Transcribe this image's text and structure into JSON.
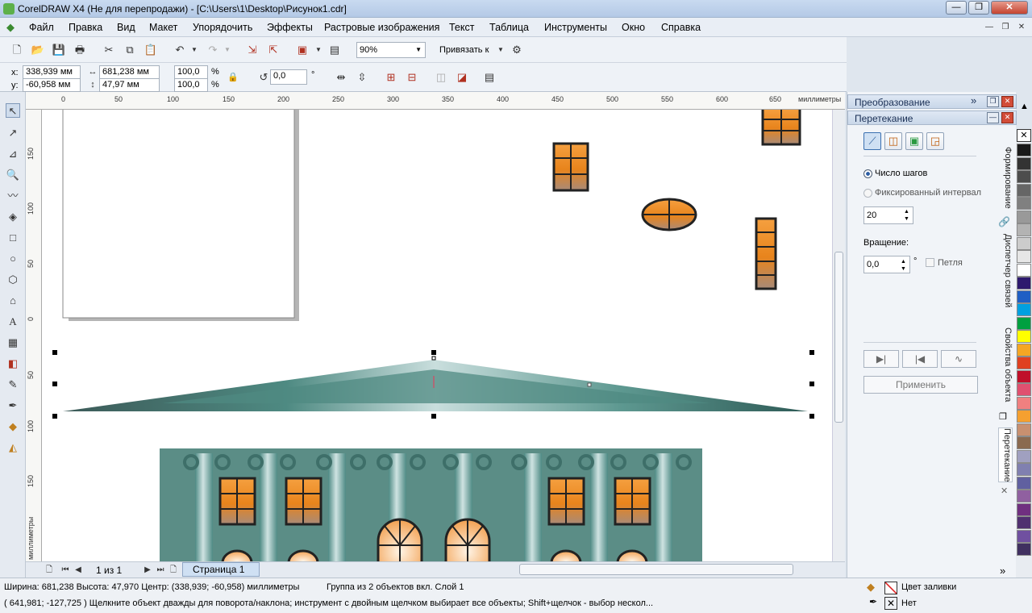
{
  "window": {
    "title": "CorelDRAW X4 (Не для перепродажи) - [C:\\Users\\1\\Desktop\\Рисунок1.cdr]",
    "min": "—",
    "max": "❐",
    "close": "✕"
  },
  "menu": [
    "Файл",
    "Правка",
    "Вид",
    "Макет",
    "Упорядочить",
    "Эффекты",
    "Растровые изображения",
    "Текст",
    "Таблица",
    "Инструменты",
    "Окно",
    "Справка"
  ],
  "toolbar": {
    "zoom": "90%",
    "snap": "Привязать к"
  },
  "props": {
    "x_label": "x:",
    "x": "338,939 мм",
    "y_label": "y:",
    "y": "-60,958 мм",
    "w": "681,238 мм",
    "h": "47,97 мм",
    "sx": "100,0",
    "sy": "100,0",
    "pct": "%",
    "rot": "0,0",
    "deg": "°"
  },
  "rulers": {
    "unit": "миллиметры",
    "top": [
      "0",
      "50",
      "100",
      "150",
      "200",
      "250",
      "300",
      "350",
      "400",
      "450",
      "500",
      "550",
      "600",
      "650"
    ],
    "left": [
      "150",
      "100",
      "50",
      "0",
      "50",
      "100",
      "150"
    ]
  },
  "pages": {
    "counter": "1 из 1",
    "tab": "Страница 1"
  },
  "status": {
    "line1": "Ширина: 681,238  Высота: 47,970  Центр: (338,939; -60,958)  миллиметры",
    "group": "Группа из 2 объектов вкл. Слой 1",
    "line2": "( 641,981; -127,725 )   Щелкните объект дважды для поворота/наклона; инструмент с двойным щелчком выбирает все объекты; Shift+щелчок - выбор нескол...",
    "fill": "Цвет заливки",
    "outline": "Нет"
  },
  "docker": {
    "transform_title": "Преобразование",
    "blend_title": "Перетекание",
    "steps_label": "Число шагов",
    "fixed_label": "Фиксированный интервал",
    "steps": "20",
    "rotation_label": "Вращение:",
    "rotation": "0,0",
    "deg": "°",
    "loop": "Петля",
    "apply": "Применить"
  },
  "vtabs": [
    "Формирование",
    "Диспетчер связей",
    "Свойства объекта",
    "Перетекание"
  ],
  "palette": [
    "#ffffff",
    "#1a1a1a",
    "#333333",
    "#4d4d4d",
    "#666666",
    "#808080",
    "#999999",
    "#b3b3b3",
    "#cccccc",
    "#e6e6e6",
    "#ffffff",
    "#2e1a6e",
    "#1f5fc4",
    "#00a0e0",
    "#00a040",
    "#ffff00",
    "#f5a623",
    "#e04020",
    "#c0102a",
    "#e05070",
    "#f08080",
    "#f5a030",
    "#c89070",
    "#8a6a50",
    "#a0a0c0",
    "#8080b0",
    "#6060a0",
    "#9060a0",
    "#703080",
    "#503070",
    "#7050a0",
    "#403060"
  ]
}
